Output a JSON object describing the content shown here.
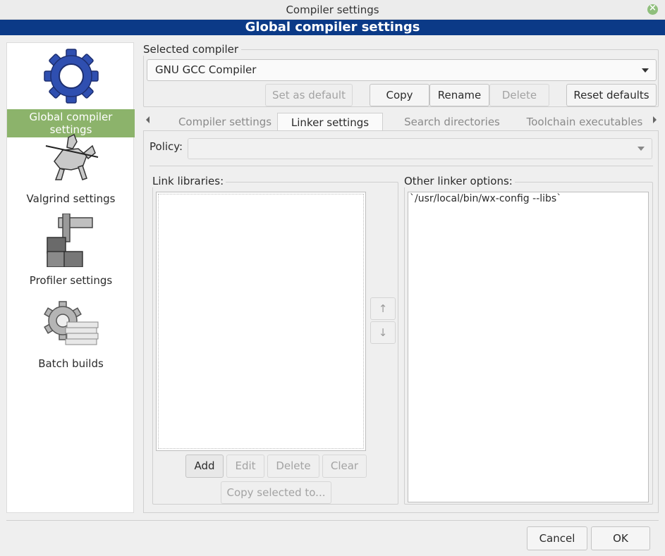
{
  "window": {
    "title": "Compiler settings",
    "banner": "Global compiler settings"
  },
  "sidebar": {
    "items": [
      {
        "label": "Global compiler settings",
        "icon": "gear-icon",
        "selected": true
      },
      {
        "label": "Valgrind settings",
        "icon": "knight-icon"
      },
      {
        "label": "Profiler settings",
        "icon": "caliper-icon"
      },
      {
        "label": "Batch builds",
        "icon": "gear-stack-icon"
      }
    ]
  },
  "compiler": {
    "group_label": "Selected compiler",
    "selected": "GNU GCC Compiler",
    "buttons": {
      "set_default": "Set as default",
      "copy": "Copy",
      "rename": "Rename",
      "delete": "Delete",
      "reset": "Reset defaults"
    }
  },
  "tabs": [
    {
      "label": "Compiler settings"
    },
    {
      "label": "Linker settings",
      "active": true
    },
    {
      "label": "Search directories"
    },
    {
      "label": "Toolchain executables"
    }
  ],
  "linker": {
    "policy_label": "Policy:",
    "policy_value": "",
    "link_libraries_label": "Link libraries:",
    "other_options_label": "Other linker options:",
    "other_options_value": "`/usr/local/bin/wx-config --libs`",
    "buttons": {
      "add": "Add",
      "edit": "Edit",
      "delete": "Delete",
      "clear": "Clear",
      "copy_to": "Copy selected to..."
    },
    "up_arrow": "↑",
    "down_arrow": "↓"
  },
  "footer": {
    "cancel": "Cancel",
    "ok": "OK"
  }
}
